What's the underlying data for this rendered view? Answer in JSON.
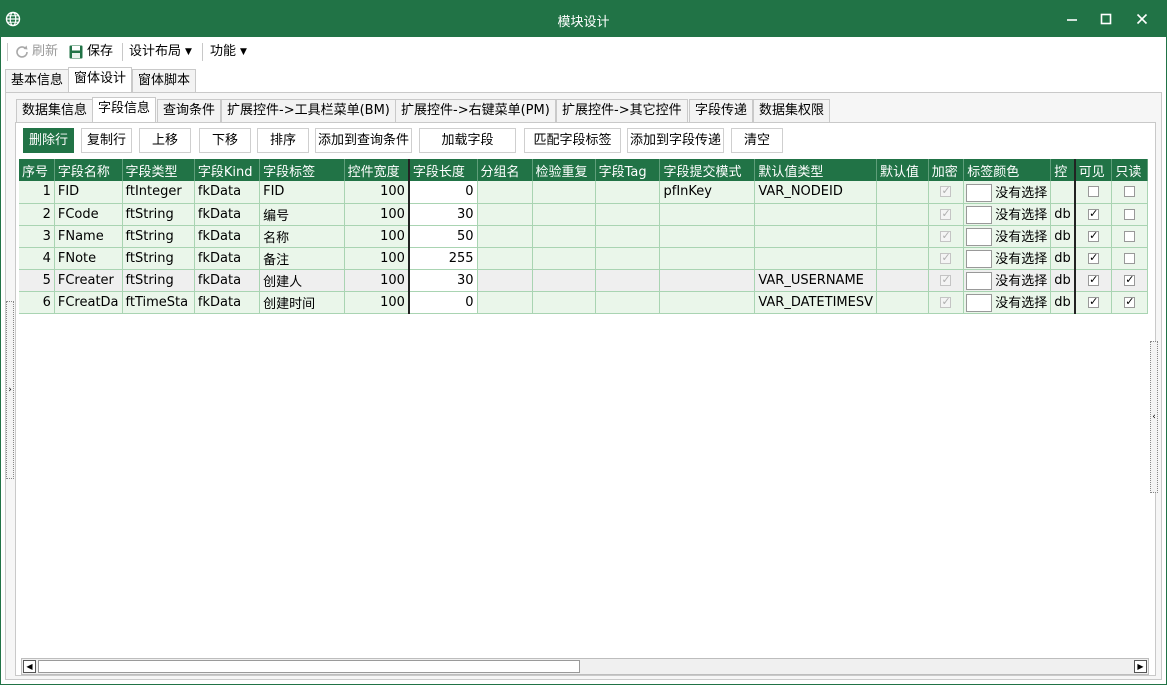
{
  "window": {
    "title": "模块设计"
  },
  "toolbar": {
    "refresh": "刷新",
    "save": "保存",
    "design_layout": "设计布局",
    "functions": "功能"
  },
  "top_tabs": [
    "基本信息",
    "窗体设计",
    "窗体脚本"
  ],
  "sub_tabs": [
    "数据集信息",
    "字段信息",
    "查询条件",
    "扩展控件->工具栏菜单(BM)",
    "扩展控件->右键菜单(PM)",
    "扩展控件->其它控件",
    "字段传递",
    "数据集权限"
  ],
  "actions": [
    "删除行",
    "复制行",
    "上移",
    "下移",
    "排序",
    "添加到查询条件",
    "加载字段",
    "匹配字段标签",
    "添加到字段传递",
    "清空"
  ],
  "grid": {
    "columns": [
      "序号",
      "字段名称",
      "字段类型",
      "字段Kind",
      "字段标签",
      "控件宽度",
      "字段长度",
      "分组名",
      "检验重复",
      "字段Tag",
      "字段提交模式",
      "默认值类型",
      "默认值",
      "加密",
      "标签颜色",
      "控",
      "可见",
      "只读"
    ],
    "rows": [
      {
        "no": "1",
        "name": "FID",
        "type": "ftInteger",
        "kind": "fkData",
        "label": "FID",
        "width": "100",
        "length": "0",
        "group": "",
        "check_dup": "",
        "tag": "",
        "submit_mode": "pfInKey",
        "default_type": "VAR_NODEID",
        "default": "",
        "encrypt": true,
        "color_text": "没有选择",
        "ctrl": "",
        "visible": false,
        "readonly": false
      },
      {
        "no": "2",
        "name": "FCode",
        "type": "ftString",
        "kind": "fkData",
        "label": "编号",
        "width": "100",
        "length": "30",
        "group": "",
        "check_dup": "",
        "tag": "",
        "submit_mode": "",
        "default_type": "",
        "default": "",
        "encrypt": true,
        "color_text": "没有选择",
        "ctrl": "db",
        "visible": true,
        "readonly": false
      },
      {
        "no": "3",
        "name": "FName",
        "type": "ftString",
        "kind": "fkData",
        "label": "名称",
        "width": "100",
        "length": "50",
        "group": "",
        "check_dup": "",
        "tag": "",
        "submit_mode": "",
        "default_type": "",
        "default": "",
        "encrypt": true,
        "color_text": "没有选择",
        "ctrl": "db",
        "visible": true,
        "readonly": false
      },
      {
        "no": "4",
        "name": "FNote",
        "type": "ftString",
        "kind": "fkData",
        "label": "备注",
        "width": "100",
        "length": "255",
        "group": "",
        "check_dup": "",
        "tag": "",
        "submit_mode": "",
        "default_type": "",
        "default": "",
        "encrypt": true,
        "color_text": "没有选择",
        "ctrl": "db",
        "visible": true,
        "readonly": false
      },
      {
        "no": "5",
        "name": "FCreater",
        "type": "ftString",
        "kind": "fkData",
        "label": "创建人",
        "width": "100",
        "length": "30",
        "group": "",
        "check_dup": "",
        "tag": "",
        "submit_mode": "",
        "default_type": "VAR_USERNAME",
        "default": "",
        "encrypt": true,
        "color_text": "没有选择",
        "ctrl": "db",
        "visible": true,
        "readonly": true
      },
      {
        "no": "6",
        "name": "FCreatDa",
        "type": "ftTimeSta",
        "kind": "fkData",
        "label": "创建时间",
        "width": "100",
        "length": "0",
        "group": "",
        "check_dup": "",
        "tag": "",
        "submit_mode": "",
        "default_type": "VAR_DATETIMESV",
        "default": "",
        "encrypt": true,
        "color_text": "没有选择",
        "ctrl": "db",
        "visible": true,
        "readonly": true
      }
    ]
  },
  "colors": {
    "accent": "#217346",
    "grid_row": "#eaf6ea",
    "grid_line": "#a9d4b2"
  }
}
